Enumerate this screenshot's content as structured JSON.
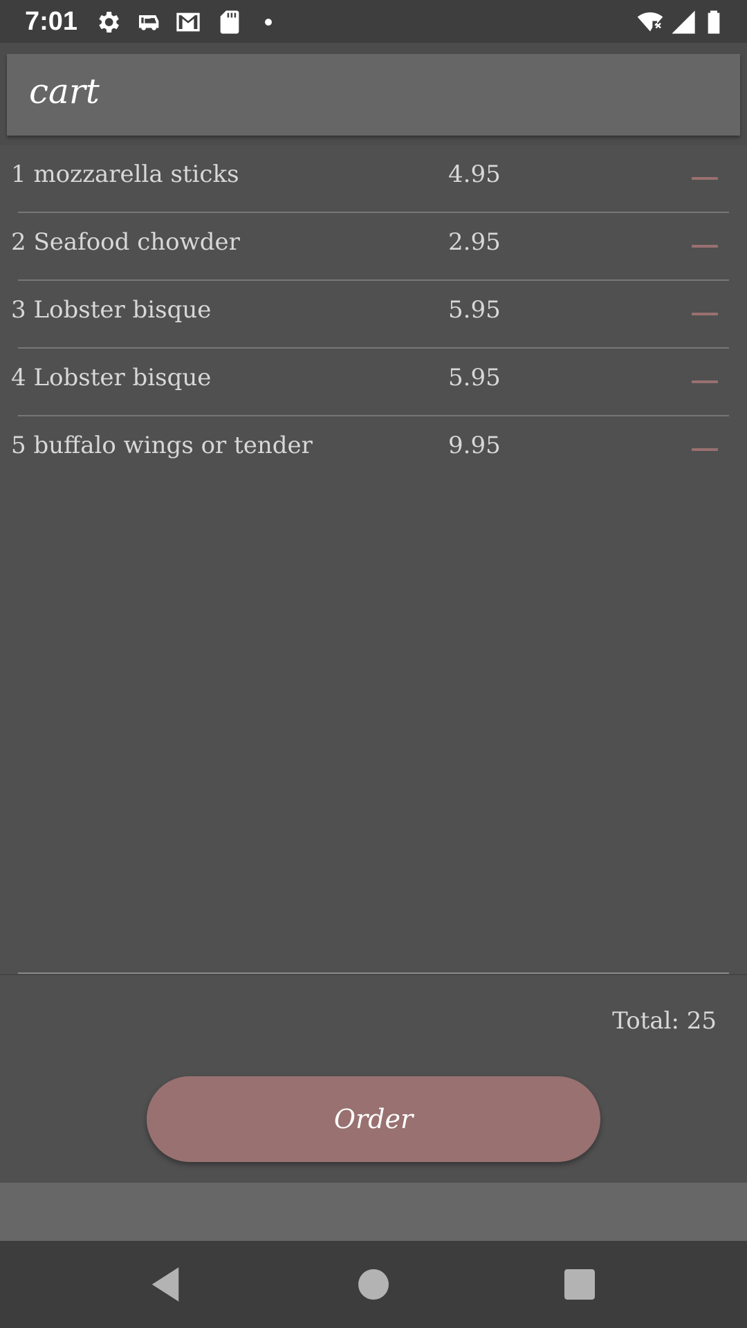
{
  "status_bar": {
    "time": "7:01",
    "icons": [
      "gear-icon",
      "car-icon",
      "mail-icon",
      "sd-card-icon",
      "dot-icon",
      "wifi-off-icon",
      "signal-icon",
      "battery-icon"
    ]
  },
  "toolbar": {
    "title": "cart"
  },
  "cart": {
    "items": [
      {
        "label": "1 mozzarella sticks",
        "price": "4.95",
        "remove_icon": "minus-icon"
      },
      {
        "label": "2 Seafood chowder",
        "price": "2.95",
        "remove_icon": "minus-icon"
      },
      {
        "label": "3 Lobster bisque",
        "price": "5.95",
        "remove_icon": "minus-icon"
      },
      {
        "label": "4 Lobster bisque",
        "price": "5.95",
        "remove_icon": "minus-icon"
      },
      {
        "label": "5 buffalo wings or tender",
        "price": "9.95",
        "remove_icon": "minus-icon"
      }
    ],
    "total_label": "Total: 25"
  },
  "order_button": {
    "label": "Order"
  },
  "nav_bar": {
    "icons": [
      "back-icon",
      "home-icon",
      "recents-icon"
    ]
  },
  "colors": {
    "background": "#505050",
    "toolbar": "#666666",
    "accent": "#997171",
    "text": "#d8d8d8"
  }
}
